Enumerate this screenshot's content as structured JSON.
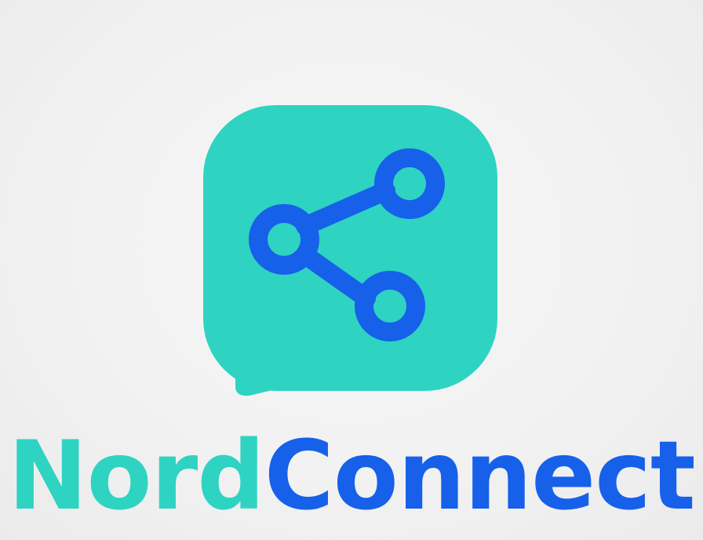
{
  "brand": {
    "name_part1": "Nord",
    "name_part2": "Connect",
    "colors": {
      "teal": "#2ed3c2",
      "blue": "#1660ea",
      "background": "#f2f2f2"
    }
  },
  "icon": {
    "name": "share-icon",
    "container": "speech-bubble"
  }
}
